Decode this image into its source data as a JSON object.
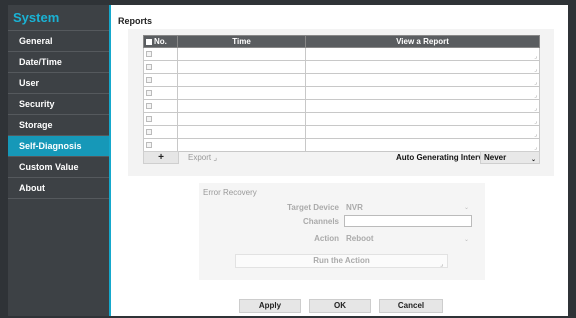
{
  "sidebar": {
    "title": "System",
    "items": [
      {
        "label": "General"
      },
      {
        "label": "Date/Time"
      },
      {
        "label": "User"
      },
      {
        "label": "Security"
      },
      {
        "label": "Storage"
      },
      {
        "label": "Self-Diagnosis",
        "active": true
      },
      {
        "label": "Custom Value"
      },
      {
        "label": "About"
      }
    ]
  },
  "reports": {
    "title": "Reports",
    "columns": [
      "No.",
      "Time",
      "View a Report"
    ],
    "row_count": 8,
    "corner_glyph": "⌟",
    "add_label": "+",
    "export_label": "Export",
    "auto_label": "Auto Generating Interval",
    "auto_value": "Never",
    "dropdown_glyph": "⌄"
  },
  "error_recovery": {
    "title": "Error Recovery",
    "target_label": "Target Device",
    "target_value": "NVR",
    "channels_label": "Channels",
    "channels_value": "",
    "action_label": "Action",
    "action_value": "Reboot",
    "run_label": "Run the Action"
  },
  "footer": {
    "apply": "Apply",
    "ok": "OK",
    "cancel": "Cancel"
  },
  "colors": {
    "accent": "#1ab2d4",
    "active_item": "#1698b8",
    "sidebar_bg": "#3d4145"
  }
}
